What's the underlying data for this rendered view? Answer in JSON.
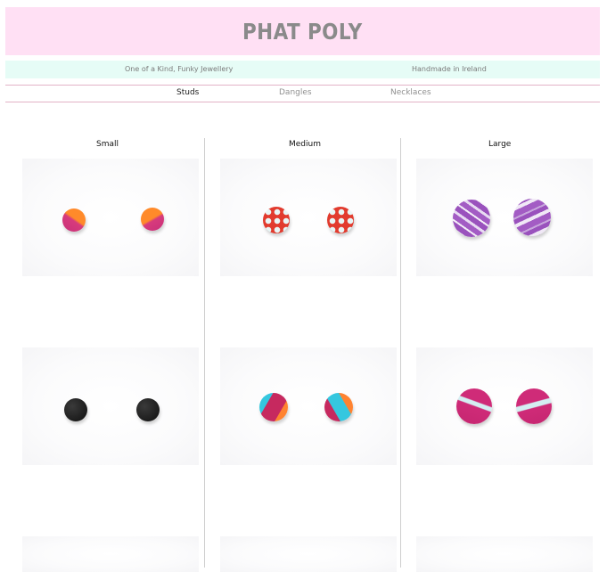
{
  "brand": {
    "logo": "PHAT POLY"
  },
  "tagline": {
    "left": "One of a Kind, Funky Jewellery",
    "right": "Handmade in Ireland"
  },
  "nav": {
    "items": [
      "Studs",
      "Dangles",
      "Necklaces"
    ],
    "active": "Studs"
  },
  "columns": [
    {
      "title": "Small",
      "products": [
        "orange-magenta studs",
        "black studs"
      ]
    },
    {
      "title": "Medium",
      "products": [
        "red polka-dot studs",
        "turquoise-magenta-orange studs"
      ]
    },
    {
      "title": "Large",
      "products": [
        "purple marble studs",
        "magenta with aqua swirl studs"
      ]
    }
  ],
  "colors": {
    "header_bg": "#ffe0f4",
    "tagline_bg": "#e6fcf6",
    "nav_border": "#e3b3c7",
    "logo": "#8a8a8a"
  }
}
